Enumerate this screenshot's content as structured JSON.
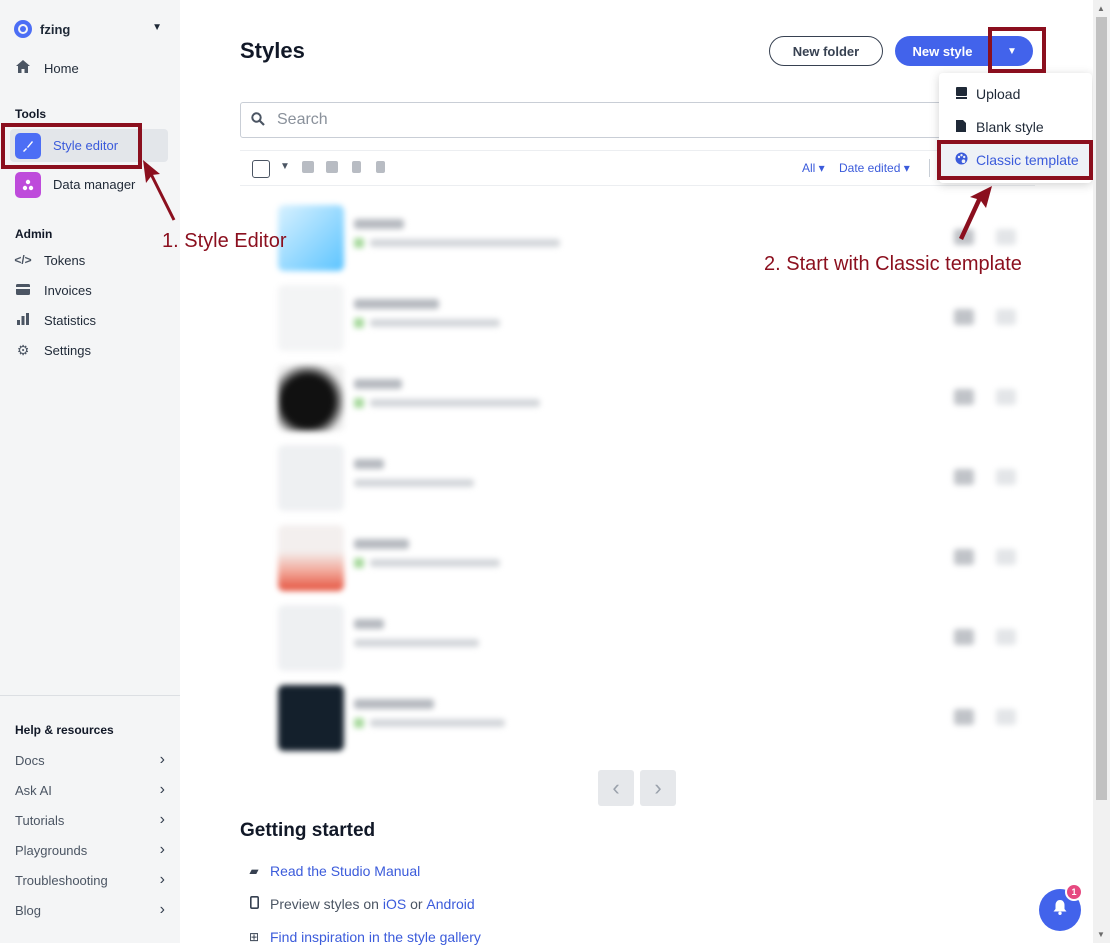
{
  "account": {
    "name": "fzing"
  },
  "sidebar": {
    "home": "Home",
    "tools_title": "Tools",
    "tools": [
      {
        "label": "Style editor",
        "color": "#4c6ef5"
      },
      {
        "label": "Data manager",
        "color": "#be4bdb"
      }
    ],
    "admin_title": "Admin",
    "admin": [
      {
        "label": "Tokens",
        "icon": "code-icon"
      },
      {
        "label": "Invoices",
        "icon": "card-icon"
      },
      {
        "label": "Statistics",
        "icon": "bar-chart-icon"
      },
      {
        "label": "Settings",
        "icon": "gear-icon"
      }
    ],
    "help_title": "Help & resources",
    "help": [
      "Docs",
      "Ask AI",
      "Tutorials",
      "Playgrounds",
      "Troubleshooting",
      "Blog"
    ]
  },
  "main": {
    "title": "Styles",
    "new_folder": "New folder",
    "new_style": "New style",
    "search_placeholder": "Search",
    "filter_all": "All",
    "filter_sort": "Date edited",
    "getting_started": "Getting started",
    "gs_manual": "Read the Studio Manual",
    "gs_preview_prefix": "Preview styles on",
    "gs_ios": "iOS",
    "gs_or": "or",
    "gs_android": "Android",
    "gs_gallery": "Find inspiration in the style gallery"
  },
  "menu": {
    "upload": "Upload",
    "blank": "Blank style",
    "classic": "Classic template"
  },
  "annotations": {
    "step1": "1. Style Editor",
    "step2": "2. Start with Classic template",
    "color": "#8b0f1e"
  },
  "notifications": {
    "count": "1"
  }
}
